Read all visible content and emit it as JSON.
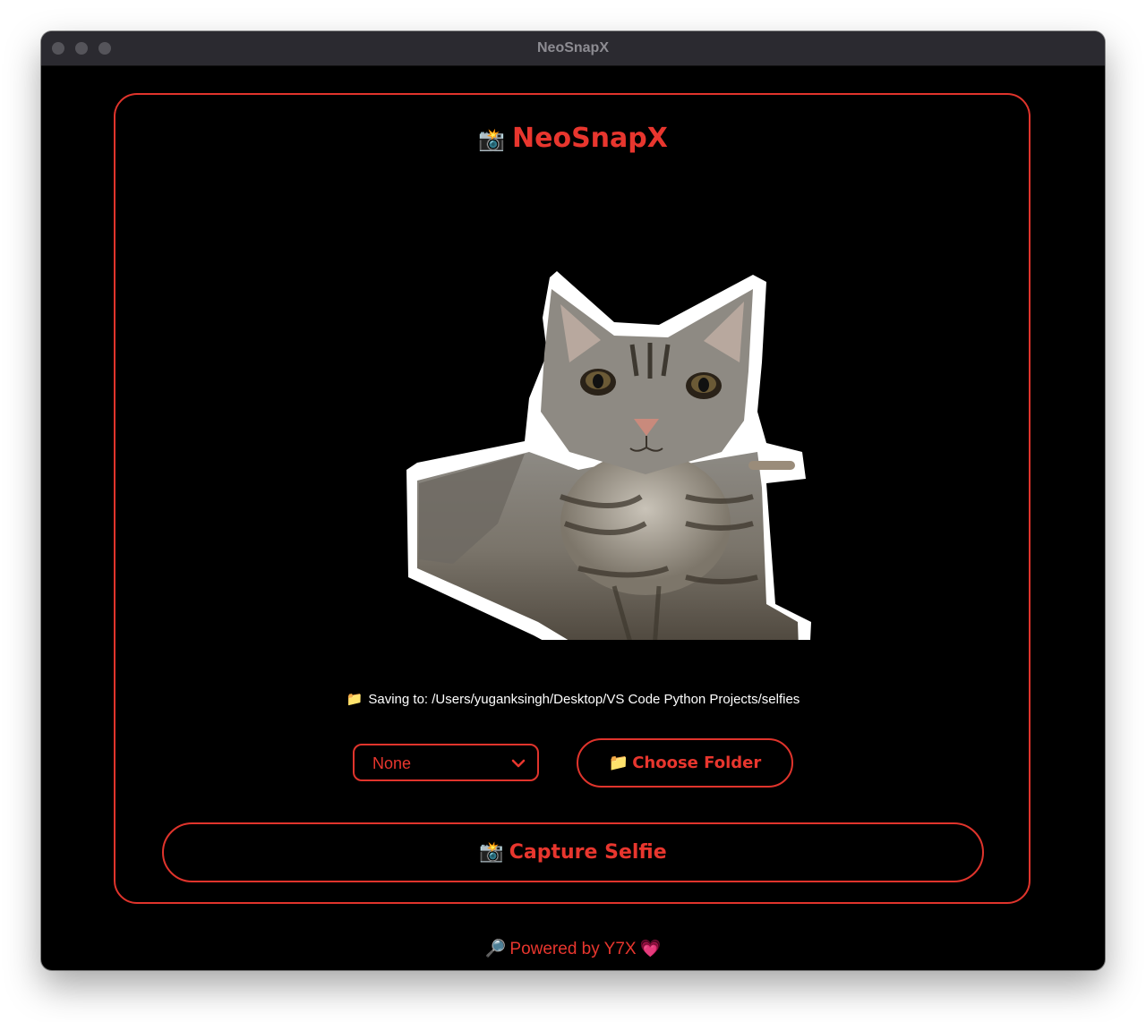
{
  "window": {
    "title": "NeoSnapX"
  },
  "app": {
    "heading_icon": "📸",
    "heading": "NeoSnapX"
  },
  "preview": {
    "subject": "tabby cat sticker"
  },
  "save_path": {
    "icon": "📁",
    "text": "Saving to: /Users/yuganksingh/Desktop/VS Code Python Projects/selfies"
  },
  "filter": {
    "selected": "None"
  },
  "folder_button": {
    "icon": "📁",
    "label": "Choose Folder"
  },
  "capture_button": {
    "icon": "📸",
    "label": "Capture Selfie"
  },
  "footer": {
    "icon_left": "🔎",
    "text": "Powered by Y7X",
    "icon_right": "💗"
  },
  "colors": {
    "accent": "#e0342c",
    "background": "#000000",
    "titlebar": "#2b2a30"
  }
}
